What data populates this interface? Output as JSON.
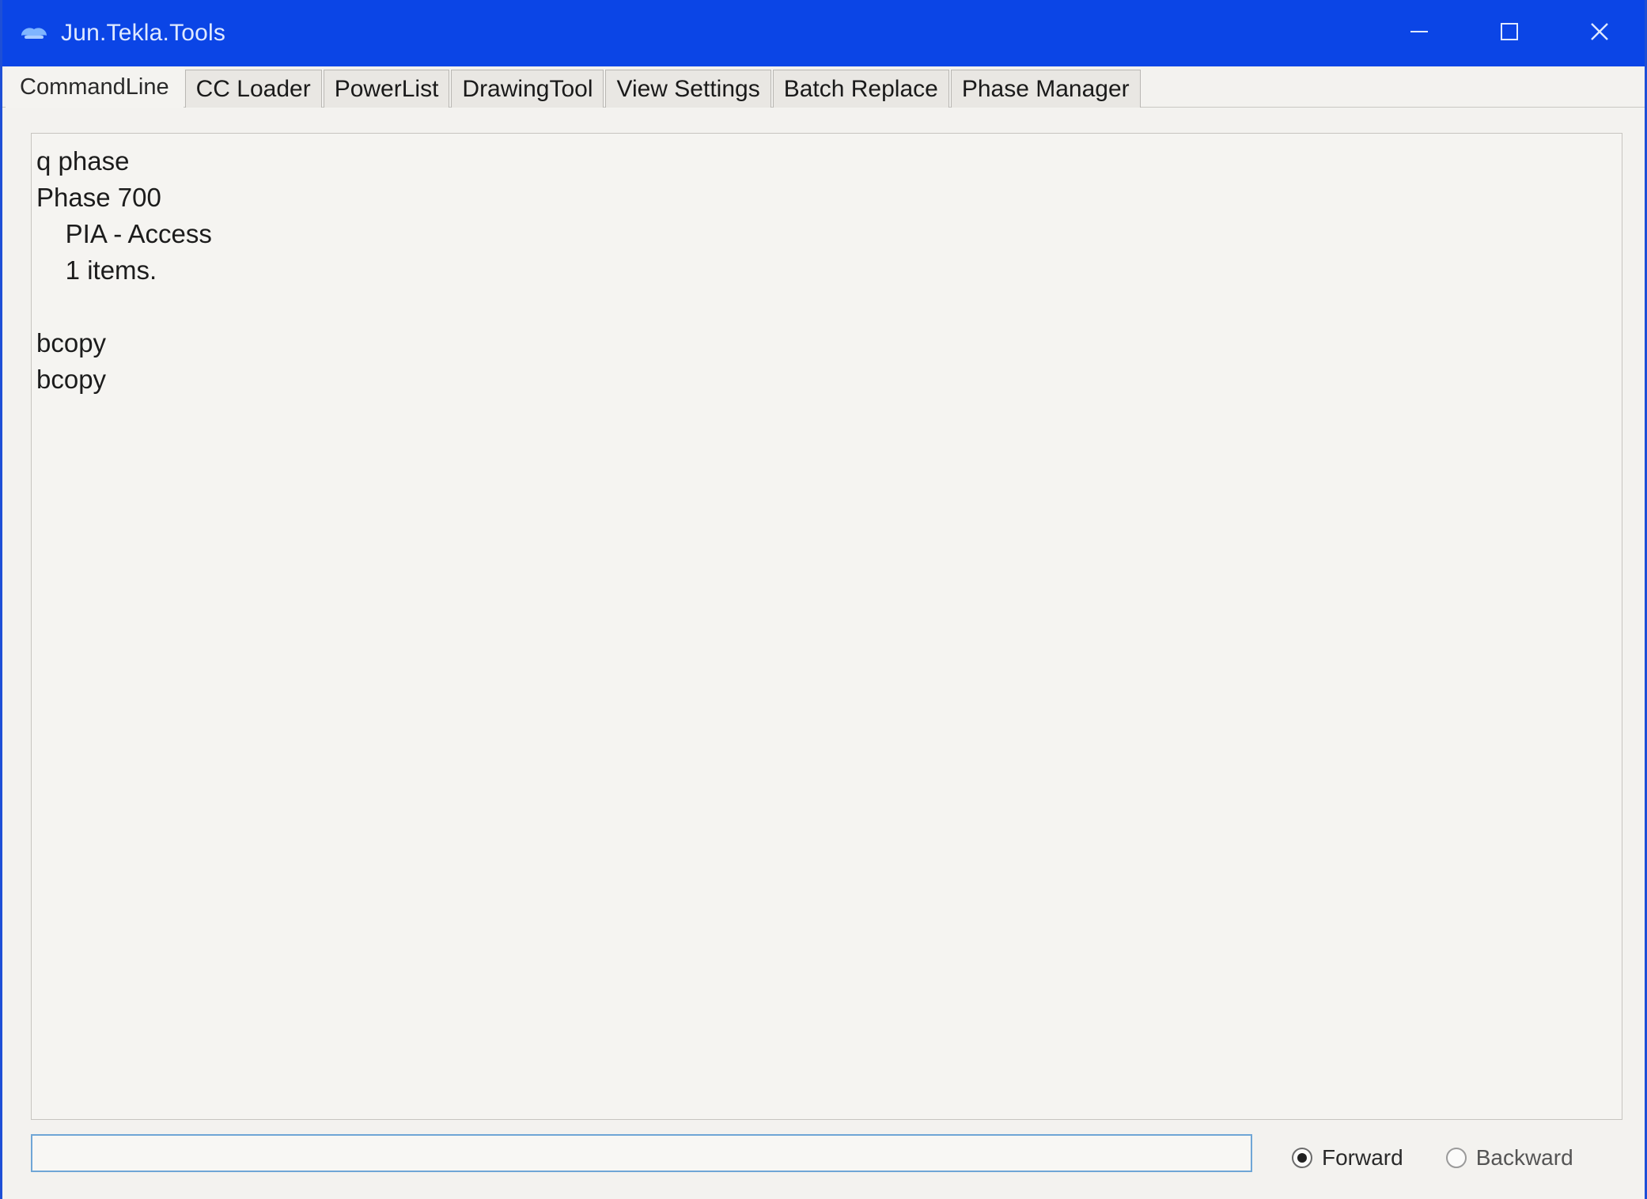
{
  "window": {
    "title": "Jun.Tekla.Tools",
    "accent_color": "#0b45e6",
    "icons": {
      "app": "tekla-app-icon",
      "minimize": "minimize-icon",
      "maximize": "maximize-icon",
      "close": "close-icon"
    }
  },
  "tabs": [
    {
      "label": "CommandLine",
      "active": true
    },
    {
      "label": "CC Loader",
      "active": false
    },
    {
      "label": "PowerList",
      "active": false
    },
    {
      "label": "DrawingTool",
      "active": false
    },
    {
      "label": "View Settings",
      "active": false
    },
    {
      "label": "Batch Replace",
      "active": false
    },
    {
      "label": "Phase Manager",
      "active": false
    }
  ],
  "output": {
    "lines": [
      "q phase",
      "Phase 700",
      "    PIA - Access",
      "    1 items.",
      "",
      "bcopy",
      "bcopy"
    ]
  },
  "command_input": {
    "value": "",
    "placeholder": ""
  },
  "direction": {
    "selected": "Forward",
    "options": [
      {
        "label": "Forward",
        "checked": true
      },
      {
        "label": "Backward",
        "checked": false
      }
    ]
  }
}
